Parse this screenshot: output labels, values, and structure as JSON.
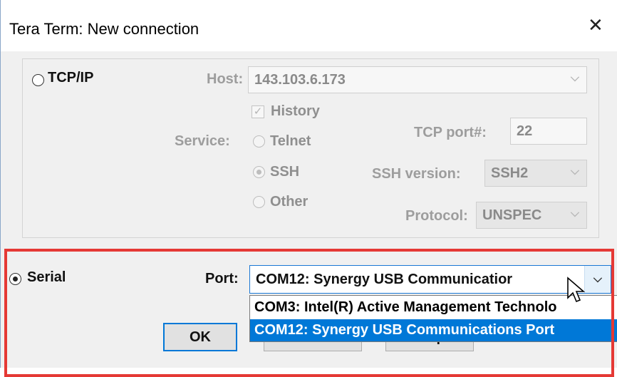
{
  "window": {
    "title": "Tera Term: New connection"
  },
  "tcpip": {
    "label": "TCP/IP",
    "host_label": "Host:",
    "host_value": "143.103.6.173",
    "history_label": "History",
    "service_label": "Service:",
    "services": [
      "Telnet",
      "SSH",
      "Other"
    ],
    "selected_service": "SSH",
    "tcp_port_label": "TCP port#:",
    "tcp_port_value": "22",
    "ssh_version_label": "SSH version:",
    "ssh_version_value": "SSH2",
    "protocol_label": "Protocol:",
    "protocol_value": "UNSPEC"
  },
  "serial": {
    "label": "Serial",
    "port_label": "Port:",
    "port_value": "COM12: Synergy USB Communicatior",
    "port_options": [
      "COM3: Intel(R) Active Management Technolo",
      "COM12: Synergy USB Communications Port"
    ],
    "selected_option_index": 1
  },
  "buttons": {
    "ok": "OK",
    "cancel": "Cancel",
    "help": "Help"
  },
  "colors": {
    "highlight": "#e53935",
    "selection": "#0078d7"
  }
}
